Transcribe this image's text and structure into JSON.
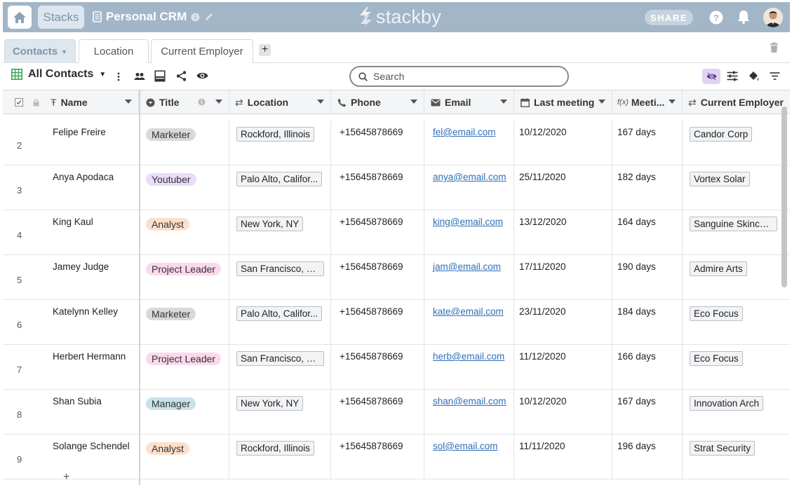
{
  "topbar": {
    "stacks_label": "Stacks",
    "stack_name": "Personal CRM",
    "logo_text": "stackby",
    "share_label": "SHARE",
    "bg_color": "#a3b6c8"
  },
  "tabs": [
    {
      "label": "Contacts",
      "active": true
    },
    {
      "label": "Location",
      "active": false
    },
    {
      "label": "Current Employer",
      "active": false
    }
  ],
  "add_tab_label": "+",
  "toolbar": {
    "view_name": "All Contacts",
    "search_placeholder": "Search"
  },
  "columns": [
    {
      "label": "Name",
      "icon": "text-icon"
    },
    {
      "label": "Title",
      "icon": "single-select-icon"
    },
    {
      "label": "Location",
      "icon": "link-icon"
    },
    {
      "label": "Phone",
      "icon": "phone-icon"
    },
    {
      "label": "Email",
      "icon": "email-icon"
    },
    {
      "label": "Last meeting",
      "icon": "calendar-icon"
    },
    {
      "label": "Meeti...",
      "icon": "formula-icon"
    },
    {
      "label": "Current Employer",
      "icon": "link-icon"
    }
  ],
  "rows": [
    {
      "num": "2",
      "name": "Felipe Freire",
      "title": "Marketer",
      "title_color": "#d9d9d9",
      "location": "Rockford, Illinois",
      "phone": "+15645878669",
      "email": "fel@email.com",
      "last_meeting": "10/12/2020",
      "days": "167 days",
      "employer": "Candor Corp"
    },
    {
      "num": "3",
      "name": "Anya Apodaca",
      "title": "Youtuber",
      "title_color": "#ebdcf9",
      "location": "Palo Alto, Califor...",
      "phone": "+15645878669",
      "email": "anya@email.com",
      "last_meeting": "25/11/2020",
      "days": "182 days",
      "employer": "Vortex Solar"
    },
    {
      "num": "4",
      "name": "King Kaul",
      "title": "Analyst",
      "title_color": "#fde0cc",
      "location": "New York, NY",
      "phone": "+15645878669",
      "email": "king@email.com",
      "last_meeting": "13/12/2020",
      "days": "164 days",
      "employer": "Sanguine Skincare"
    },
    {
      "num": "5",
      "name": "Jamey Judge",
      "title": "Project Leader",
      "title_color": "#fbd9ec",
      "location": "San Francisco, C...",
      "phone": "+15645878669",
      "email": "jam@email.com",
      "last_meeting": "17/11/2020",
      "days": "190 days",
      "employer": "Admire Arts"
    },
    {
      "num": "6",
      "name": "Katelynn Kelley",
      "title": "Marketer",
      "title_color": "#d9d9d9",
      "location": "Palo Alto, Califor...",
      "phone": "+15645878669",
      "email": "kate@email.com",
      "last_meeting": "23/11/2020",
      "days": "184 days",
      "employer": "Eco Focus"
    },
    {
      "num": "7",
      "name": "Herbert Hermann",
      "title": "Project Leader",
      "title_color": "#fbd9ec",
      "location": "San Francisco, C...",
      "phone": "+15645878669",
      "email": "herb@email.com",
      "last_meeting": "11/12/2020",
      "days": "166 days",
      "employer": "Eco Focus"
    },
    {
      "num": "8",
      "name": "Shan Subia",
      "title": "Manager",
      "title_color": "#c8e2ea",
      "location": "New York, NY",
      "phone": "+15645878669",
      "email": "shan@email.com",
      "last_meeting": "10/12/2020",
      "days": "167 days",
      "employer": "Innovation Arch"
    },
    {
      "num": "9",
      "name": "Solange Schendel",
      "title": "Analyst",
      "title_color": "#fde0cc",
      "location": "Rockford, Illinois",
      "phone": "+15645878669",
      "email": "sol@email.com",
      "last_meeting": "11/11/2020",
      "days": "196 days",
      "employer": "Strat Security"
    }
  ],
  "add_row_label": "+"
}
